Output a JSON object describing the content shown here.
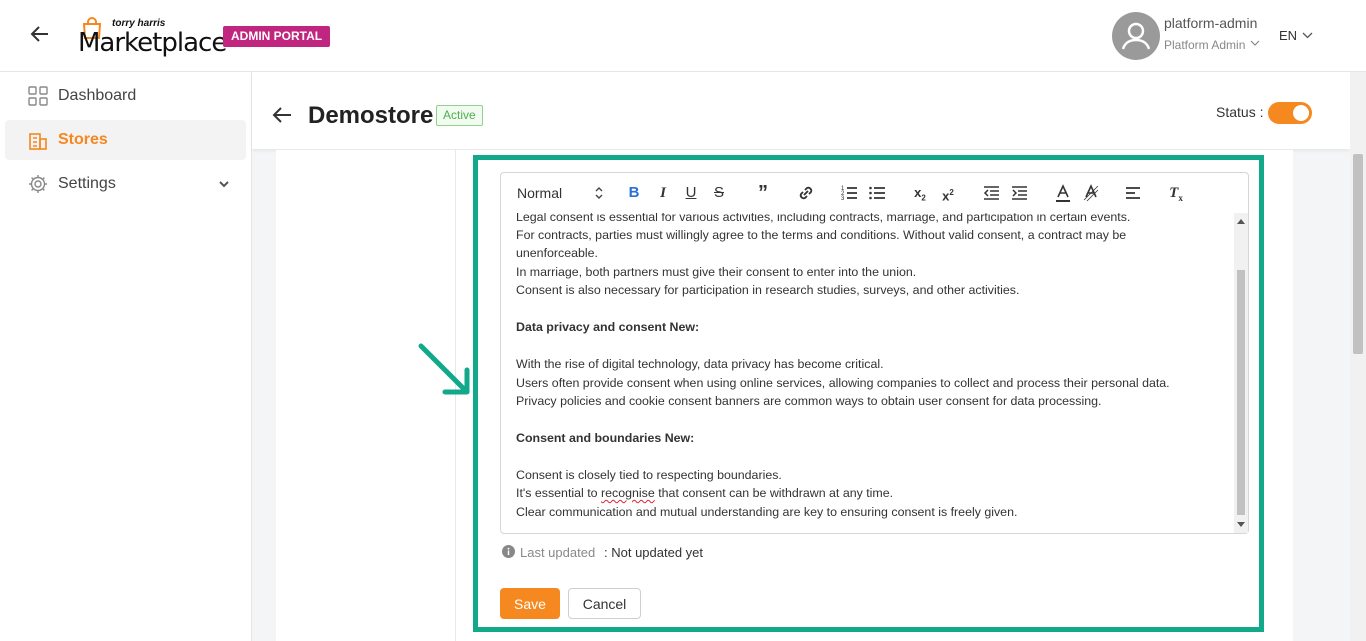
{
  "header": {
    "logo_small": "torry harris",
    "logo_main": "Marketplace",
    "portal_badge": "ADMIN PORTAL",
    "user_name": "platform-admin",
    "user_role": "Platform Admin",
    "language": "EN"
  },
  "sidebar": {
    "items": [
      {
        "label": "Dashboard",
        "icon": "dashboard-grid-icon"
      },
      {
        "label": "Stores",
        "icon": "store-building-icon",
        "active": true
      },
      {
        "label": "Settings",
        "icon": "gear-icon"
      }
    ]
  },
  "page": {
    "title": "Demostore",
    "status_badge": "Active",
    "status_label": "Status :",
    "status_on": true
  },
  "editor": {
    "format_select": "Normal",
    "lines": [
      "Legal consent is essential for various activities, including contracts, marriage, and participation in certain events.",
      "For contracts, parties must willingly agree to the terms and conditions. Without valid consent, a contract may be",
      "unenforceable.",
      "In marriage, both partners must give their consent to enter into the union.",
      "Consent is also necessary for participation in research studies, surveys, and other activities.",
      "Data privacy and consent New:",
      "With the rise of digital technology, data privacy has become critical.",
      "Users often provide consent when using online services, allowing companies to collect and process their personal data.",
      "Privacy policies and cookie consent banners are common ways to obtain user consent for data processing.",
      "Consent and boundaries New:",
      "Consent is closely tied to respecting boundaries.",
      "It's essential to",
      "recognise",
      "that consent can be withdrawn at any time.",
      "Clear communication and mutual understanding are key to ensuring consent is freely given."
    ]
  },
  "footer": {
    "last_updated_label": "Last updated",
    "last_updated_value": ": Not updated yet",
    "save_label": "Save",
    "cancel_label": "Cancel"
  },
  "colors": {
    "accent": "#f5881f",
    "admin_badge": "#c0267f",
    "highlight": "#12a88a",
    "active_green": "#4caf50"
  }
}
